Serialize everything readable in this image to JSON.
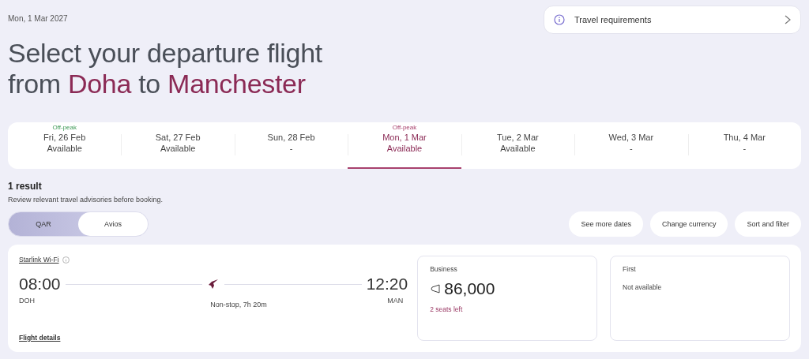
{
  "header": {
    "date": "Mon, 1 Mar 2027",
    "title_line1": "Select your departure flight",
    "title_parts": [
      {
        "text": "from ",
        "highlight": false
      },
      {
        "text": "Doha",
        "highlight": true
      },
      {
        "text": " to ",
        "highlight": false
      },
      {
        "text": "Manchester",
        "highlight": true
      }
    ]
  },
  "travel_requirements": {
    "label": "Travel requirements"
  },
  "dates": [
    {
      "tag": "Off-peak",
      "date": "Fri, 26 Feb",
      "status": "Available",
      "selected": false
    },
    {
      "date": "Sat, 27 Feb",
      "status": "Available",
      "selected": false
    },
    {
      "date": "Sun, 28 Feb",
      "status": "-",
      "selected": false
    },
    {
      "tag": "Off-peak",
      "date": "Mon, 1 Mar",
      "status": "Available",
      "selected": true
    },
    {
      "date": "Tue, 2 Mar",
      "status": "Available",
      "selected": false
    },
    {
      "date": "Wed, 3 Mar",
      "status": "-",
      "selected": false
    },
    {
      "date": "Thu, 4 Mar",
      "status": "-",
      "selected": false
    }
  ],
  "results": {
    "count": "1 result",
    "advisory": "Review relevant travel advisories before booking."
  },
  "currency_toggle": [
    {
      "label": "QAR",
      "selected": true
    },
    {
      "label": "Avios",
      "selected": false
    }
  ],
  "actions": [
    "See more dates",
    "Change currency",
    "Sort and filter"
  ],
  "flight": {
    "wifi": "Starlink Wi-Fi",
    "depart_time": "08:00",
    "depart_code": "DOH",
    "duration": "Non-stop, 7h 20m",
    "arrive_time": "12:20",
    "arrive_code": "MAN",
    "details_link": "Flight details",
    "fares": [
      {
        "kind": "price",
        "cabin": "Business",
        "price": "86,000",
        "note": "2 seats left"
      },
      {
        "kind": "unavailable",
        "cabin": "First",
        "note": "Not available"
      }
    ]
  }
}
